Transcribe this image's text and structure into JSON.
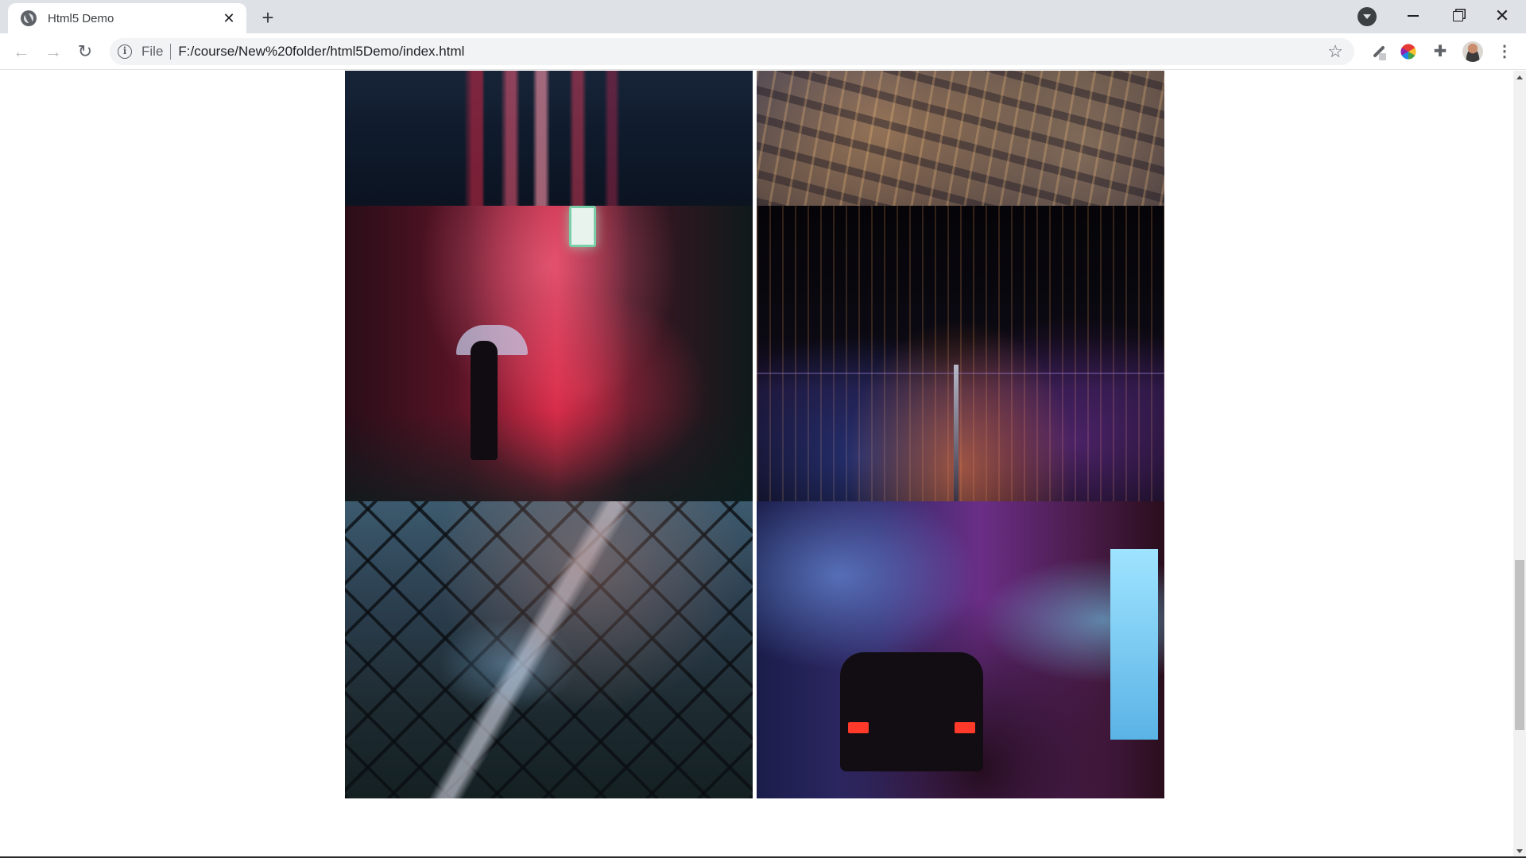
{
  "browser": {
    "tab": {
      "title": "Html5 Demo",
      "favicon": "globe-icon",
      "close_glyph": "✕"
    },
    "new_tab_glyph": "+",
    "window_controls": [
      "minimize-icon",
      "restore-icon",
      "close-icon"
    ],
    "close_glyph": "✕",
    "nav": {
      "back_glyph": "←",
      "forward_glyph": "→",
      "reload_glyph": "↻"
    },
    "omnibox": {
      "info_glyph": "i",
      "scheme_label": "File",
      "url": "F:/course/New%20folder/html5Demo/index.html",
      "bookmark_glyph": "☆"
    },
    "extensions": [
      "pen-icon",
      "color-wheel-icon",
      "puzzle-icon"
    ],
    "puzzle_glyph": "✚",
    "menu_glyph": "⋮"
  },
  "gallery": {
    "photos": [
      {
        "subject": "neon rainy street reflection"
      },
      {
        "subject": "aerial city at night"
      },
      {
        "subject": "neon alley with umbrella"
      },
      {
        "subject": "city skyline at night with tower"
      },
      {
        "subject": "bridge seen through chain-link fence"
      },
      {
        "subject": "neon street with taxi"
      }
    ]
  },
  "colors": {
    "tabbar_bg": "#dee1e6",
    "omnibox_bg": "#f1f3f4",
    "page_bg": "#ffffff"
  }
}
